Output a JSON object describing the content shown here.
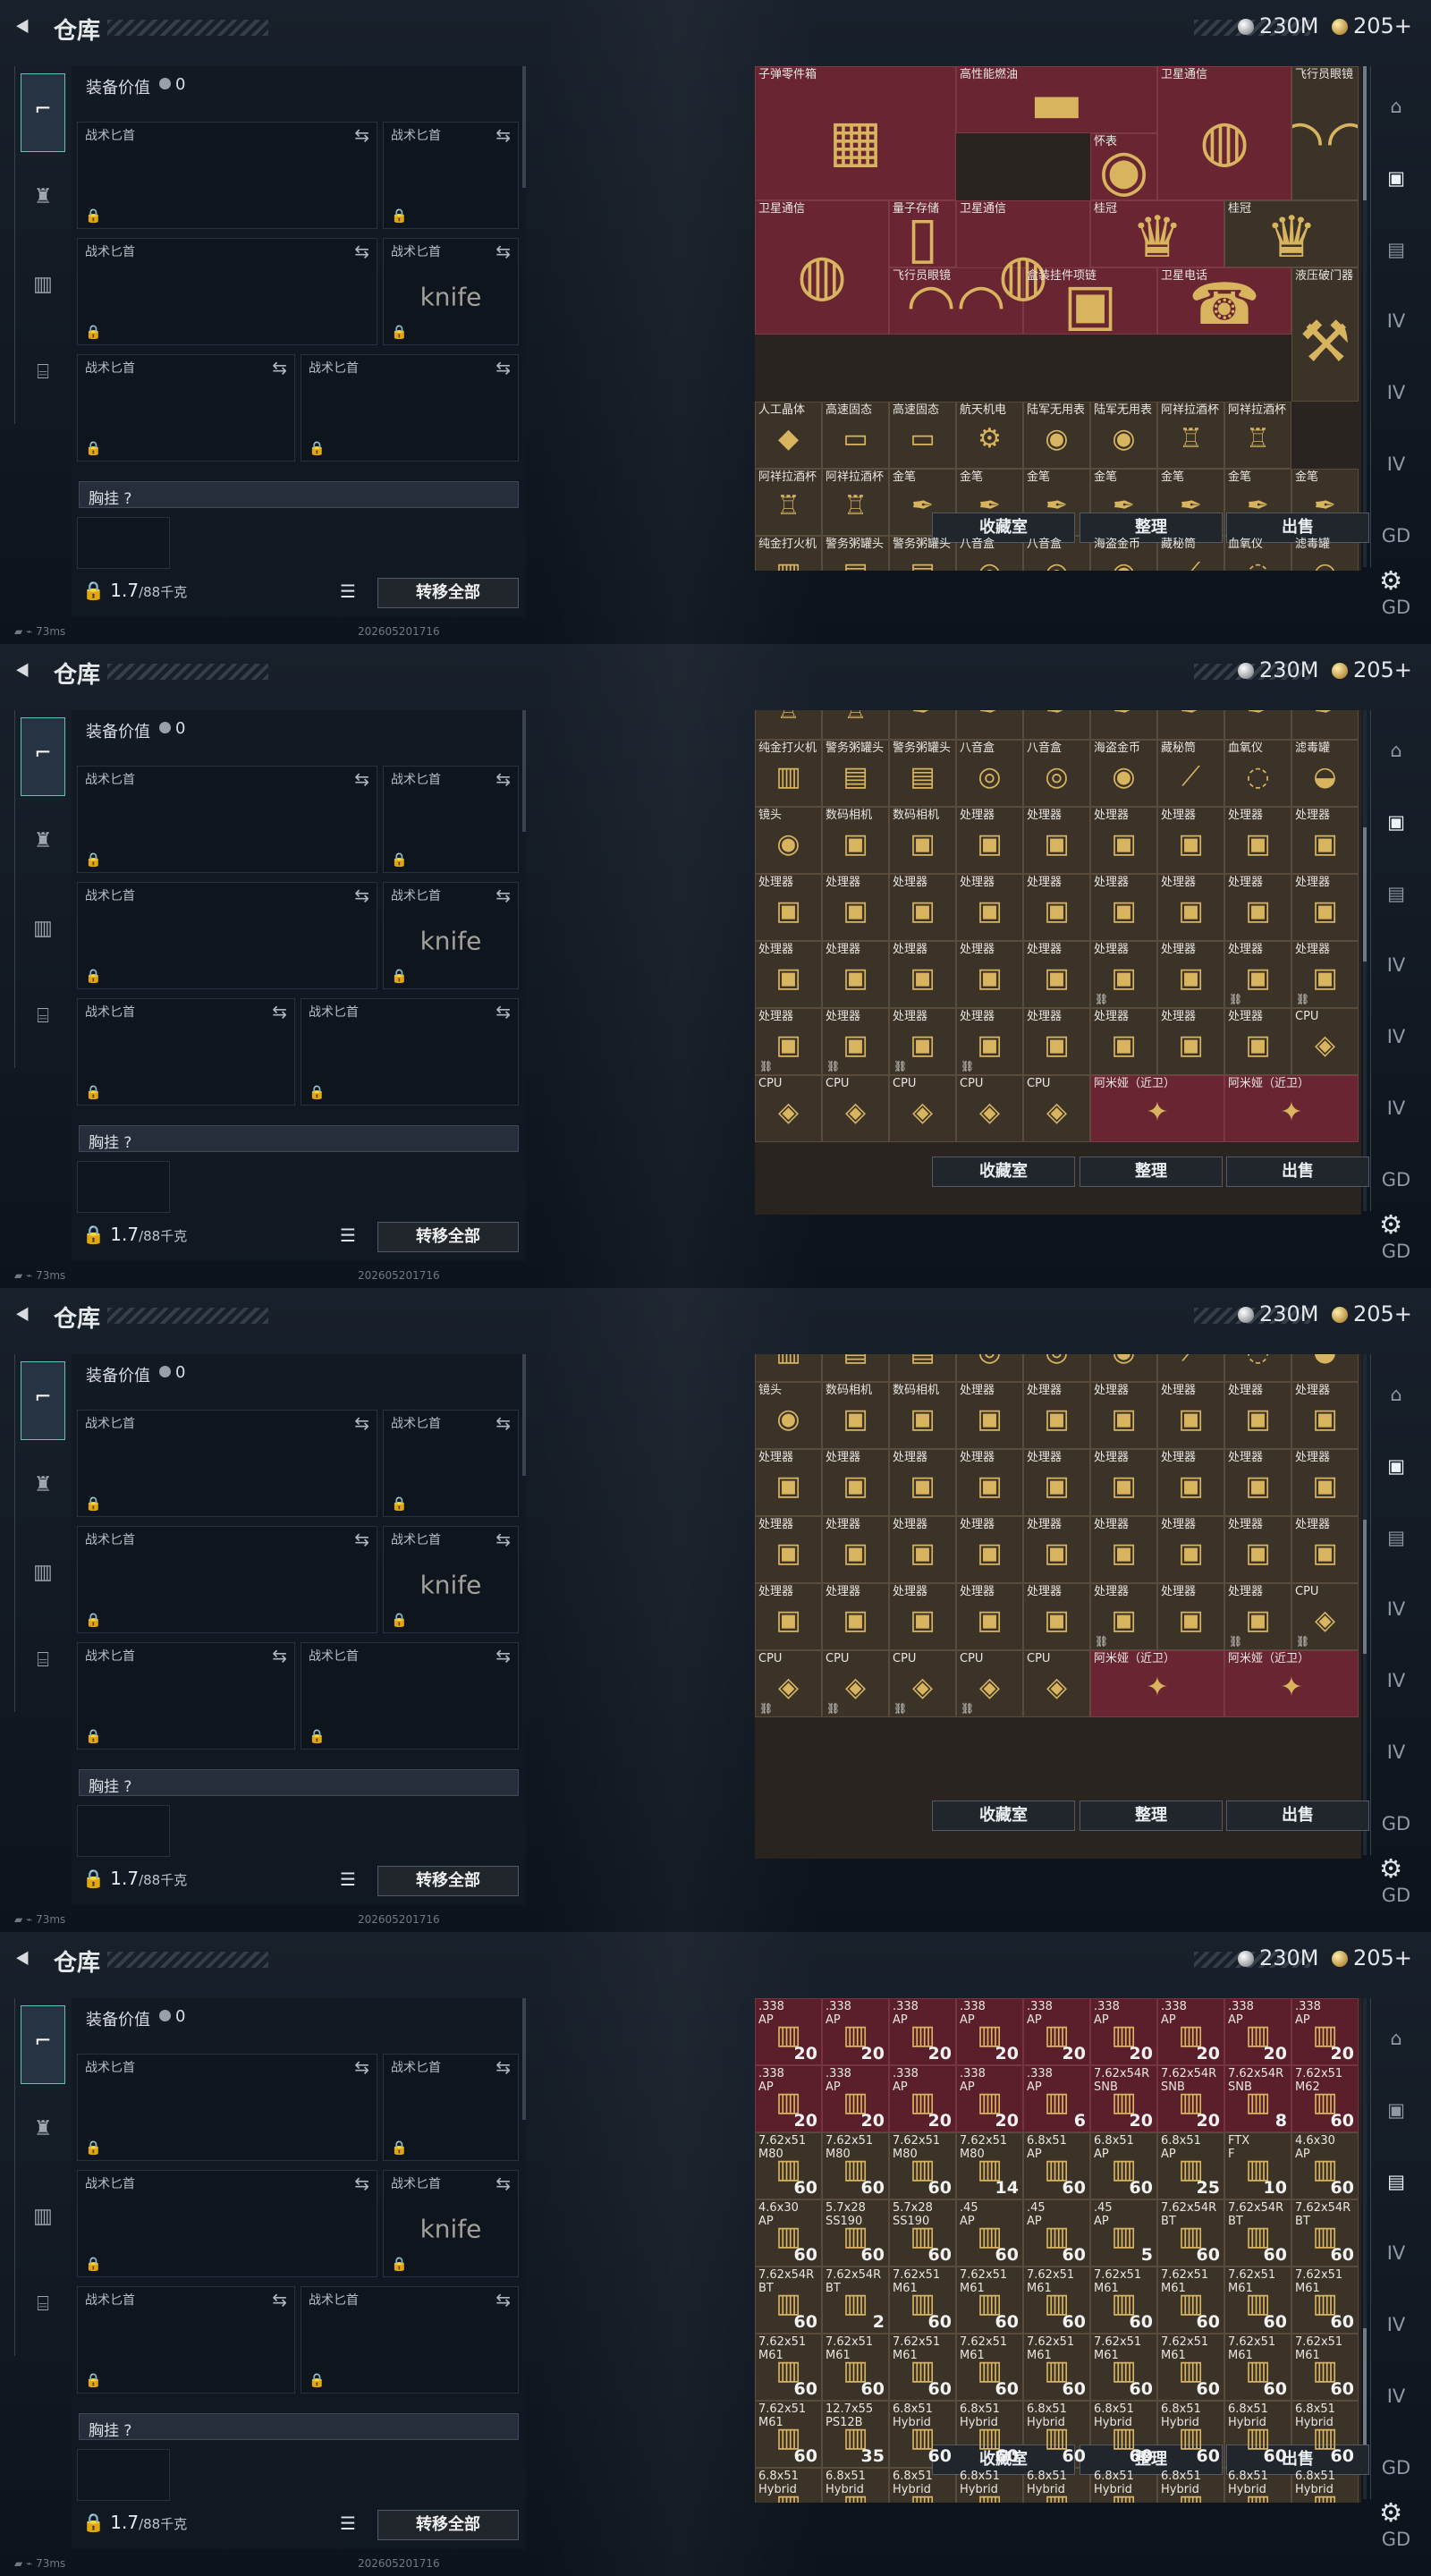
{
  "panels": [
    {
      "id": "p1",
      "scroll": 0
    },
    {
      "id": "p2",
      "scroll": 0.32
    },
    {
      "id": "p3",
      "scroll": 0.45
    },
    {
      "id": "p4",
      "scroll": 0.9
    }
  ],
  "header": {
    "back": "⯇",
    "title": "仓库",
    "currency1": "230M",
    "currency2": "205+"
  },
  "equipment": {
    "title": "装备价值",
    "value": "0",
    "knife_label": "战术匕首",
    "chest_label": "胸挂 ?",
    "weight": "1.7",
    "weight_unit": "/88千克",
    "transfer": "转移全部",
    "status": "73ms",
    "stamp": "202605201716"
  },
  "buttons": {
    "collection": "收藏室",
    "sort": "整理",
    "sell": "出售"
  },
  "inventory_pages": [
    {
      "label": "valuables_top",
      "items": [
        [
          "子弹零件箱",
          "big"
        ],
        [
          "高性能燃油",
          "wide"
        ],
        [
          "卫星通信",
          "sat"
        ],
        [
          "飞行员眼镜",
          "glasses"
        ],
        [
          "卫星通信",
          "sat"
        ],
        [
          "怀表",
          "watch"
        ],
        [
          "卫星通信",
          "sat"
        ],
        [
          "量子存储",
          "drive"
        ],
        [
          "桂冠",
          "crown"
        ],
        [
          "桂冠",
          "crown"
        ],
        [
          "飞行员眼镜",
          "glasses"
        ],
        [
          "盒装挂件项链",
          "box"
        ],
        [
          "卫星电话",
          "phone"
        ],
        [
          "液压破门器",
          "tool"
        ],
        [
          "人工晶体",
          "crystal"
        ],
        [
          "高速固态",
          "ssd"
        ],
        [
          "高速固态",
          "ssd"
        ],
        [
          "航天机电",
          "robot"
        ],
        [
          "陆军无用表",
          "watch"
        ],
        [
          "陆军无用表",
          "watch"
        ],
        [
          "阿祥拉酒杯",
          "cup"
        ],
        [
          "阿祥拉酒杯",
          "cup"
        ],
        [
          "阿祥拉酒杯",
          "cup"
        ],
        [
          "阿祥拉酒杯",
          "cup"
        ],
        [
          "金笔",
          "pen"
        ],
        [
          "金笔",
          "pen"
        ],
        [
          "金笔",
          "pen"
        ],
        [
          "金笔",
          "pen"
        ],
        [
          "金笔",
          "pen"
        ],
        [
          "金笔",
          "pen"
        ],
        [
          "金笔",
          "pen"
        ],
        [
          "纯金打火机",
          "lighter"
        ],
        [
          "警务粥罐头",
          "can"
        ],
        [
          "警务粥罐头",
          "can"
        ],
        [
          "八音盒",
          "musicbox"
        ],
        [
          "八音盒",
          "musicbox"
        ],
        [
          "海盗金币",
          "coin"
        ],
        [
          "藏秘筒",
          "bullet"
        ],
        [
          "血氧仪",
          "sensor"
        ],
        [
          "滤毒罐",
          "filter"
        ],
        [
          "镜头",
          "lens"
        ],
        [
          "数码相机",
          "camera"
        ],
        [
          "数码相机",
          "camera"
        ],
        [
          "处理器",
          "cpu"
        ],
        [
          "处理器",
          "cpu"
        ],
        [
          "处理器",
          "cpu"
        ],
        [
          "处理器",
          "cpu"
        ],
        [
          "处理器",
          "cpu"
        ],
        [
          "处理器",
          "cpu"
        ]
      ]
    },
    {
      "label": "valuables_mid",
      "items": [
        [
          "阿祥拉酒杯",
          "cup"
        ],
        [
          "阿祥拉酒杯",
          "cup"
        ],
        [
          "金笔",
          "pen"
        ],
        [
          "金笔",
          "pen"
        ],
        [
          "金笔",
          "pen"
        ],
        [
          "金笔",
          "pen"
        ],
        [
          "金笔",
          "pen"
        ],
        [
          "金笔",
          "pen"
        ],
        [
          "金笔",
          "pen"
        ],
        [
          "纯金打火机",
          "lighter"
        ],
        [
          "警务粥罐头",
          "can"
        ],
        [
          "警务粥罐头",
          "can"
        ],
        [
          "八音盒",
          "musicbox"
        ],
        [
          "八音盒",
          "musicbox"
        ],
        [
          "海盗金币",
          "coin"
        ],
        [
          "藏秘筒",
          "bullet"
        ],
        [
          "血氧仪",
          "sensor"
        ],
        [
          "滤毒罐",
          "filter"
        ],
        [
          "镜头",
          "lens"
        ],
        [
          "数码相机",
          "camera"
        ],
        [
          "数码相机",
          "camera"
        ],
        [
          "处理器",
          "cpu"
        ],
        [
          "处理器",
          "cpu"
        ],
        [
          "处理器",
          "cpu"
        ],
        [
          "处理器",
          "cpu"
        ],
        [
          "处理器",
          "cpu"
        ],
        [
          "处理器",
          "cpu"
        ],
        [
          "处理器",
          "cpu"
        ],
        [
          "处理器",
          "cpu"
        ],
        [
          "处理器",
          "cpu"
        ],
        [
          "处理器",
          "cpu"
        ],
        [
          "处理器",
          "cpu"
        ],
        [
          "处理器",
          "cpu"
        ],
        [
          "处理器",
          "cpu"
        ],
        [
          "处理器",
          "cpu"
        ],
        [
          "处理器",
          "cpu"
        ],
        [
          "处理器",
          "cpu"
        ],
        [
          "处理器",
          "cpu"
        ],
        [
          "处理器",
          "cpu"
        ],
        [
          "处理器",
          "cpu"
        ],
        [
          "处理器",
          "cpu"
        ],
        [
          "处理器",
          "cpu"
        ],
        [
          "处理器",
          "cpu"
        ],
        [
          "处理器",
          "cpu"
        ],
        [
          "处理器",
          "cpu"
        ],
        [
          "处理器",
          "cpu"
        ],
        [
          "处理器",
          "cpu"
        ],
        [
          "处理器",
          "cpu"
        ],
        [
          "处理器",
          "cpu"
        ],
        [
          "处理器",
          "cpu"
        ],
        [
          "处理器",
          "cpu"
        ],
        [
          "处理器",
          "cpu"
        ],
        [
          "处理器",
          "cpu"
        ],
        [
          "CPU",
          "chip"
        ],
        [
          "CPU",
          "chip"
        ],
        [
          "CPU",
          "chip"
        ],
        [
          "CPU",
          "chip"
        ],
        [
          "CPU",
          "chip"
        ],
        [
          "CPU",
          "chip"
        ],
        [
          "阿米娅（近卫）",
          "doll"
        ],
        [
          "阿米娅（近卫）",
          "doll"
        ]
      ]
    },
    {
      "label": "valuables_low",
      "items": [
        [
          "纯金打火机",
          "lighter"
        ],
        [
          "警务粥罐头",
          "can"
        ],
        [
          "警务粥罐头",
          "can"
        ],
        [
          "八音盒",
          "musicbox"
        ],
        [
          "八音盒",
          "musicbox"
        ],
        [
          "海盗金币",
          "coin"
        ],
        [
          "藏秘筒",
          "bullet"
        ],
        [
          "血氧仪",
          "sensor"
        ],
        [
          "滤毒罐",
          "filter"
        ],
        [
          "镜头",
          "lens"
        ],
        [
          "数码相机",
          "camera"
        ],
        [
          "数码相机",
          "camera"
        ],
        [
          "处理器",
          "cpu"
        ],
        [
          "处理器",
          "cpu"
        ],
        [
          "处理器",
          "cpu"
        ],
        [
          "处理器",
          "cpu"
        ],
        [
          "处理器",
          "cpu"
        ],
        [
          "处理器",
          "cpu"
        ],
        [
          "处理器",
          "cpu"
        ],
        [
          "处理器",
          "cpu"
        ],
        [
          "处理器",
          "cpu"
        ],
        [
          "处理器",
          "cpu"
        ],
        [
          "处理器",
          "cpu"
        ],
        [
          "处理器",
          "cpu"
        ],
        [
          "处理器",
          "cpu"
        ],
        [
          "处理器",
          "cpu"
        ],
        [
          "处理器",
          "cpu"
        ],
        [
          "处理器",
          "cpu"
        ],
        [
          "处理器",
          "cpu"
        ],
        [
          "处理器",
          "cpu"
        ],
        [
          "处理器",
          "cpu"
        ],
        [
          "处理器",
          "cpu"
        ],
        [
          "处理器",
          "cpu"
        ],
        [
          "处理器",
          "cpu"
        ],
        [
          "处理器",
          "cpu"
        ],
        [
          "处理器",
          "cpu"
        ],
        [
          "处理器",
          "cpu"
        ],
        [
          "处理器",
          "cpu"
        ],
        [
          "处理器",
          "cpu"
        ],
        [
          "处理器",
          "cpu"
        ],
        [
          "处理器",
          "cpu"
        ],
        [
          "处理器",
          "cpu"
        ],
        [
          "处理器",
          "cpu"
        ],
        [
          "处理器",
          "cpu"
        ],
        [
          "CPU",
          "chip"
        ],
        [
          "CPU",
          "chip"
        ],
        [
          "CPU",
          "chip"
        ],
        [
          "CPU",
          "chip"
        ],
        [
          "CPU",
          "chip"
        ],
        [
          "CPU",
          "chip"
        ],
        [
          "阿米娅（近卫）",
          "doll"
        ],
        [
          "阿米娅（近卫）",
          "doll"
        ]
      ]
    },
    {
      "label": "ammo",
      "items": [
        [
          ".338\nAP",
          "ammo",
          "20"
        ],
        [
          ".338\nAP",
          "ammo",
          "20"
        ],
        [
          ".338\nAP",
          "ammo",
          "20"
        ],
        [
          ".338\nAP",
          "ammo",
          "20"
        ],
        [
          ".338\nAP",
          "ammo",
          "20"
        ],
        [
          ".338\nAP",
          "ammo",
          "20"
        ],
        [
          ".338\nAP",
          "ammo",
          "20"
        ],
        [
          ".338\nAP",
          "ammo",
          "20"
        ],
        [
          ".338\nAP",
          "ammo",
          "20"
        ],
        [
          ".338\nAP",
          "ammo",
          "20"
        ],
        [
          ".338\nAP",
          "ammo",
          "20"
        ],
        [
          ".338\nAP",
          "ammo",
          "20"
        ],
        [
          ".338\nAP",
          "ammo",
          "20"
        ],
        [
          ".338\nAP",
          "ammo",
          "6"
        ],
        [
          "7.62x54R\nSNB",
          "ammo",
          "20"
        ],
        [
          "7.62x54R\nSNB",
          "ammo",
          "20"
        ],
        [
          "7.62x54R\nSNB",
          "ammo",
          "8"
        ],
        [
          "7.62x51\nM62",
          "ammo",
          "60"
        ],
        [
          "7.62x51\nM80",
          "ammo",
          "60"
        ],
        [
          "7.62x51\nM80",
          "ammo",
          "60"
        ],
        [
          "7.62x51\nM80",
          "ammo",
          "60"
        ],
        [
          "7.62x51\nM80",
          "ammo",
          "14"
        ],
        [
          "6.8x51\nAP",
          "ammo",
          "60"
        ],
        [
          "6.8x51\nAP",
          "ammo",
          "60"
        ],
        [
          "6.8x51\nAP",
          "ammo",
          "25"
        ],
        [
          "FTX\nF",
          "ammo",
          "10"
        ],
        [
          "4.6x30\nAP",
          "ammo",
          "60"
        ],
        [
          "4.6x30\nAP",
          "ammo",
          "60"
        ],
        [
          "5.7x28\nSS190",
          "ammo",
          "60"
        ],
        [
          "5.7x28\nSS190",
          "ammo",
          "60"
        ],
        [
          ".45\nAP",
          "ammo",
          "60"
        ],
        [
          ".45\nAP",
          "ammo",
          "60"
        ],
        [
          ".45\nAP",
          "ammo",
          "5"
        ],
        [
          "7.62x54R\nBT",
          "ammo",
          "60"
        ],
        [
          "7.62x54R\nBT",
          "ammo",
          "60"
        ],
        [
          "7.62x54R\nBT",
          "ammo",
          "60"
        ],
        [
          "7.62x54R\nBT",
          "ammo",
          "60"
        ],
        [
          "7.62x54R\nBT",
          "ammo",
          "2"
        ],
        [
          "7.62x51\nM61",
          "ammo",
          "60"
        ],
        [
          "7.62x51\nM61",
          "ammo",
          "60"
        ],
        [
          "7.62x51\nM61",
          "ammo",
          "60"
        ],
        [
          "7.62x51\nM61",
          "ammo",
          "60"
        ],
        [
          "7.62x51\nM61",
          "ammo",
          "60"
        ],
        [
          "7.62x51\nM61",
          "ammo",
          "60"
        ],
        [
          "7.62x51\nM61",
          "ammo",
          "60"
        ],
        [
          "7.62x51\nM61",
          "ammo",
          "60"
        ],
        [
          "7.62x51\nM61",
          "ammo",
          "60"
        ],
        [
          "7.62x51\nM61",
          "ammo",
          "60"
        ],
        [
          "7.62x51\nM61",
          "ammo",
          "60"
        ],
        [
          "7.62x51\nM61",
          "ammo",
          "60"
        ],
        [
          "7.62x51\nM61",
          "ammo",
          "60"
        ],
        [
          "7.62x51\nM61",
          "ammo",
          "60"
        ],
        [
          "7.62x51\nM61",
          "ammo",
          "60"
        ],
        [
          "7.62x51\nM61",
          "ammo",
          "60"
        ],
        [
          "7.62x51\nM61",
          "ammo",
          "60"
        ],
        [
          "12.7x55\nPS12B",
          "ammo",
          "35"
        ],
        [
          "6.8x51\nHybrid",
          "ammo",
          "60"
        ],
        [
          "6.8x51\nHybrid",
          "ammo",
          "60"
        ],
        [
          "6.8x51\nHybrid",
          "ammo",
          "60"
        ],
        [
          "6.8x51\nHybrid",
          "ammo",
          "60"
        ],
        [
          "6.8x51\nHybrid",
          "ammo",
          "60"
        ],
        [
          "6.8x51\nHybrid",
          "ammo",
          "60"
        ],
        [
          "6.8x51\nHybrid",
          "ammo",
          "60"
        ],
        [
          "6.8x51\nHybrid",
          "ammo",
          "60"
        ],
        [
          "6.8x51\nHybrid",
          "ammo",
          "60"
        ],
        [
          "6.8x51\nHybrid",
          "ammo",
          "60"
        ],
        [
          "6.8x51\nHybrid",
          "ammo",
          "60"
        ],
        [
          "6.8x51\nHybrid",
          "ammo",
          "60"
        ],
        [
          "6.8x51\nHybrid",
          "ammo",
          "60"
        ],
        [
          "6.8x51\nHybrid",
          "ammo",
          "60"
        ],
        [
          "6.8x51\nHybrid",
          "ammo",
          "60"
        ],
        [
          "6.8x51\nHybrid",
          "ammo",
          "60"
        ]
      ]
    }
  ]
}
